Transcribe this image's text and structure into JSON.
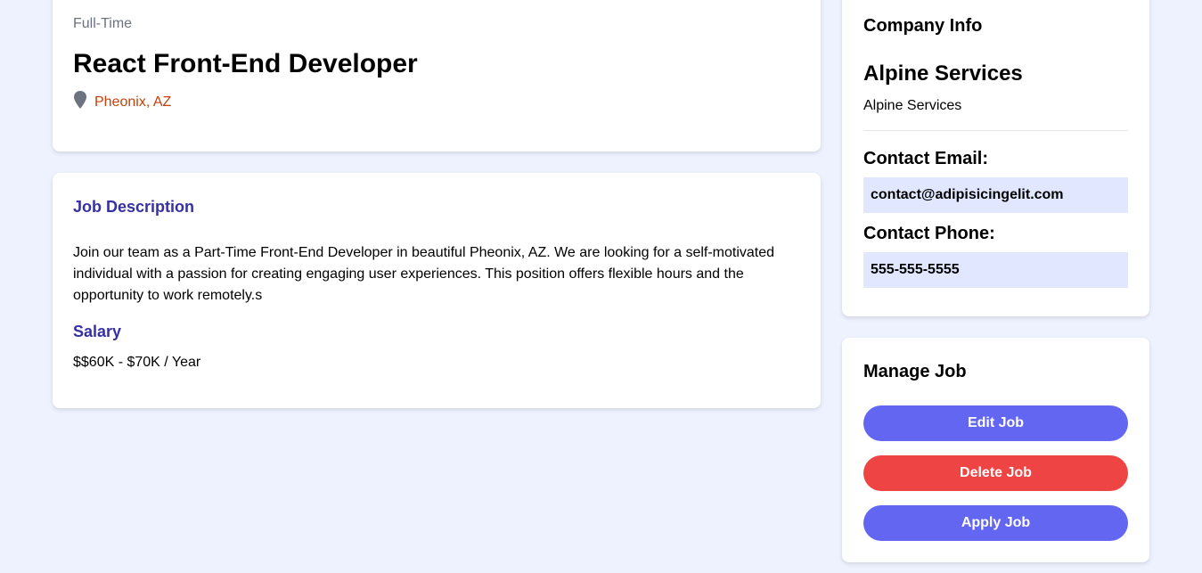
{
  "job": {
    "type": "Full-Time",
    "title": "React Front-End Developer",
    "location": "Pheonix, AZ",
    "description_heading": "Job Description",
    "description": "Join our team as a Part-Time Front-End Developer in beautiful Pheonix, AZ. We are looking for a self-motivated individual with a passion for creating engaging user experiences. This position offers flexible hours and the opportunity to work remotely.s",
    "salary_heading": "Salary",
    "salary": "$$60K - $70K / Year"
  },
  "company": {
    "heading": "Company Info",
    "name": "Alpine Services",
    "description": "Alpine Services",
    "email_label": "Contact Email:",
    "email": "contact@adipisicingelit.com",
    "phone_label": "Contact Phone:",
    "phone": "555-555-5555"
  },
  "manage": {
    "heading": "Manage Job",
    "edit_label": "Edit Job",
    "delete_label": "Delete Job",
    "apply_label": "Apply Job"
  },
  "icons": {
    "location": "map-marker-icon"
  },
  "colors": {
    "background": "#eef2fe",
    "accent": "#6366f1",
    "danger": "#ef4444",
    "section_title": "#3730a3",
    "location": "#c2410c",
    "contact_box": "#e0e7ff"
  }
}
